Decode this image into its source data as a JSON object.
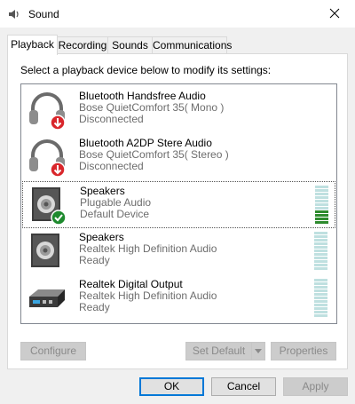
{
  "window": {
    "title": "Sound",
    "icon": "speaker-settings-icon"
  },
  "tabs": [
    {
      "label": "Playback",
      "active": true
    },
    {
      "label": "Recording",
      "active": false
    },
    {
      "label": "Sounds",
      "active": false
    },
    {
      "label": "Communications",
      "active": false
    }
  ],
  "instruction": "Select a playback device below to modify its settings:",
  "devices": [
    {
      "name": "Bluetooth Handsfree Audio",
      "description": "Bose QuietComfort 35( Mono )",
      "status": "Disconnected",
      "icon": "headset-disconnected-icon",
      "meter_level": null
    },
    {
      "name": "Bluetooth A2DP Stere Audio",
      "description": "Bose QuietComfort 35( Stereo )",
      "status": "Disconnected",
      "icon": "headset-disconnected-icon",
      "meter_level": null
    },
    {
      "name": "Speakers",
      "description": "Plugable Audio",
      "status": "Default Device",
      "icon": "speaker-default-icon",
      "meter_level": 0.4
    },
    {
      "name": "Speakers",
      "description": "Realtek High Definition Audio",
      "status": "Ready",
      "icon": "speaker-icon",
      "meter_level": 0
    },
    {
      "name": "Realtek Digital Output",
      "description": "Realtek High Definition Audio",
      "status": "Ready",
      "icon": "digital-output-icon",
      "meter_level": 0
    }
  ],
  "buttons": {
    "configure": "Configure",
    "set_default": "Set Default",
    "properties": "Properties",
    "ok": "OK",
    "cancel": "Cancel",
    "apply": "Apply"
  },
  "colors": {
    "meter_on": "#2e8b2e",
    "meter_off": "#bfe0e0",
    "focus_border": "#0078d7",
    "badge_red": "#d9262b",
    "badge_green": "#1e8a2e"
  }
}
